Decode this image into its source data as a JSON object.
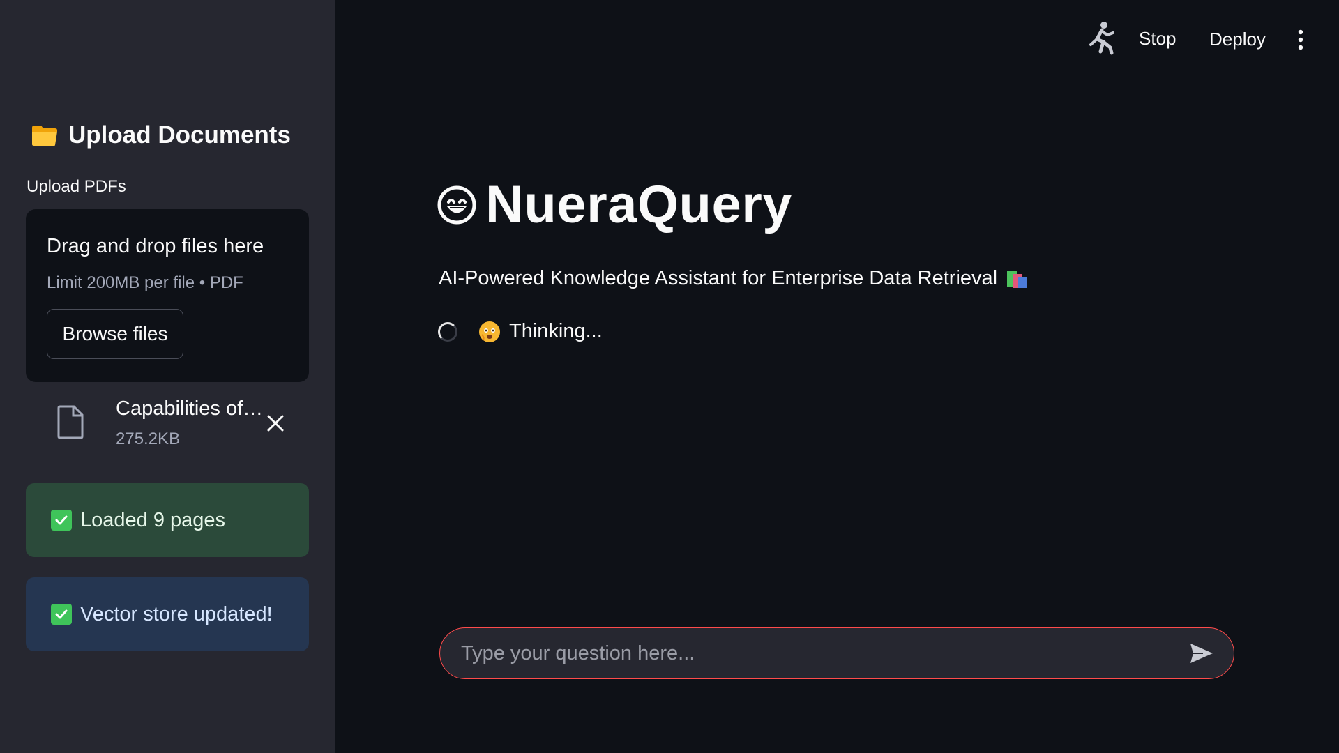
{
  "sidebar": {
    "header": "Upload Documents",
    "upload_label": "Upload PDFs",
    "dropzone": {
      "title": "Drag and drop files here",
      "limit": "Limit 200MB per file • PDF",
      "browse_label": "Browse files"
    },
    "file": {
      "name": "Capabilities of…",
      "size": "275.2KB"
    },
    "alerts": {
      "success": "Loaded 9 pages",
      "info": "Vector store updated!"
    }
  },
  "toolbar": {
    "stop_label": "Stop",
    "deploy_label": "Deploy"
  },
  "main": {
    "title": "NueraQuery",
    "subtitle": "AI-Powered Knowledge Assistant for Enterprise Data Retrieval",
    "status": "Thinking..."
  },
  "chat": {
    "placeholder": "Type your question here..."
  },
  "icons": {
    "folder": "folder-icon",
    "file": "file-icon",
    "close": "close-icon",
    "check": "check-icon",
    "running": "running-man-icon",
    "menu": "kebab-menu-icon",
    "smile": "grinning-face-icon",
    "books": "books-icon",
    "worried": "worried-face-icon",
    "send": "send-icon"
  },
  "colors": {
    "background": "#0e1117",
    "sidebar": "#262730",
    "accent": "#ff4b4b",
    "success_bg": "#2b4a3a",
    "info_bg": "#253651",
    "check": "#3fc45a"
  }
}
